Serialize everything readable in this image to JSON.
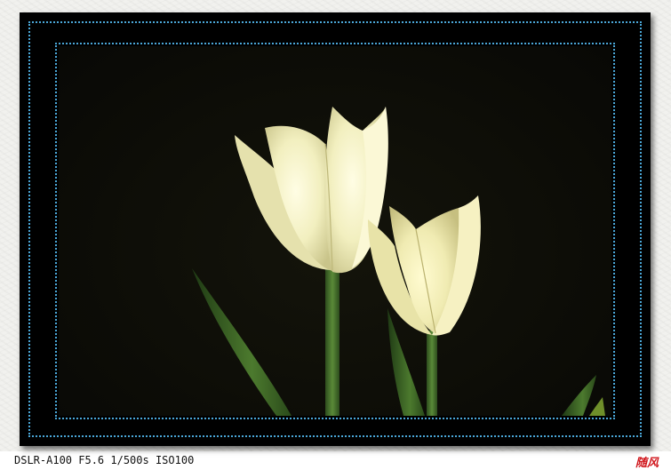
{
  "caption": {
    "camera_settings": "DSLR-A100 F5.6 1/500s ISO100"
  },
  "signature": {
    "text": "随风"
  },
  "colors": {
    "frame_dots": "#4aa7d8",
    "background": "#0d0d07",
    "petal": "#f4f1c8",
    "stem": "#3f6a2a",
    "signature": "#d0151b"
  }
}
